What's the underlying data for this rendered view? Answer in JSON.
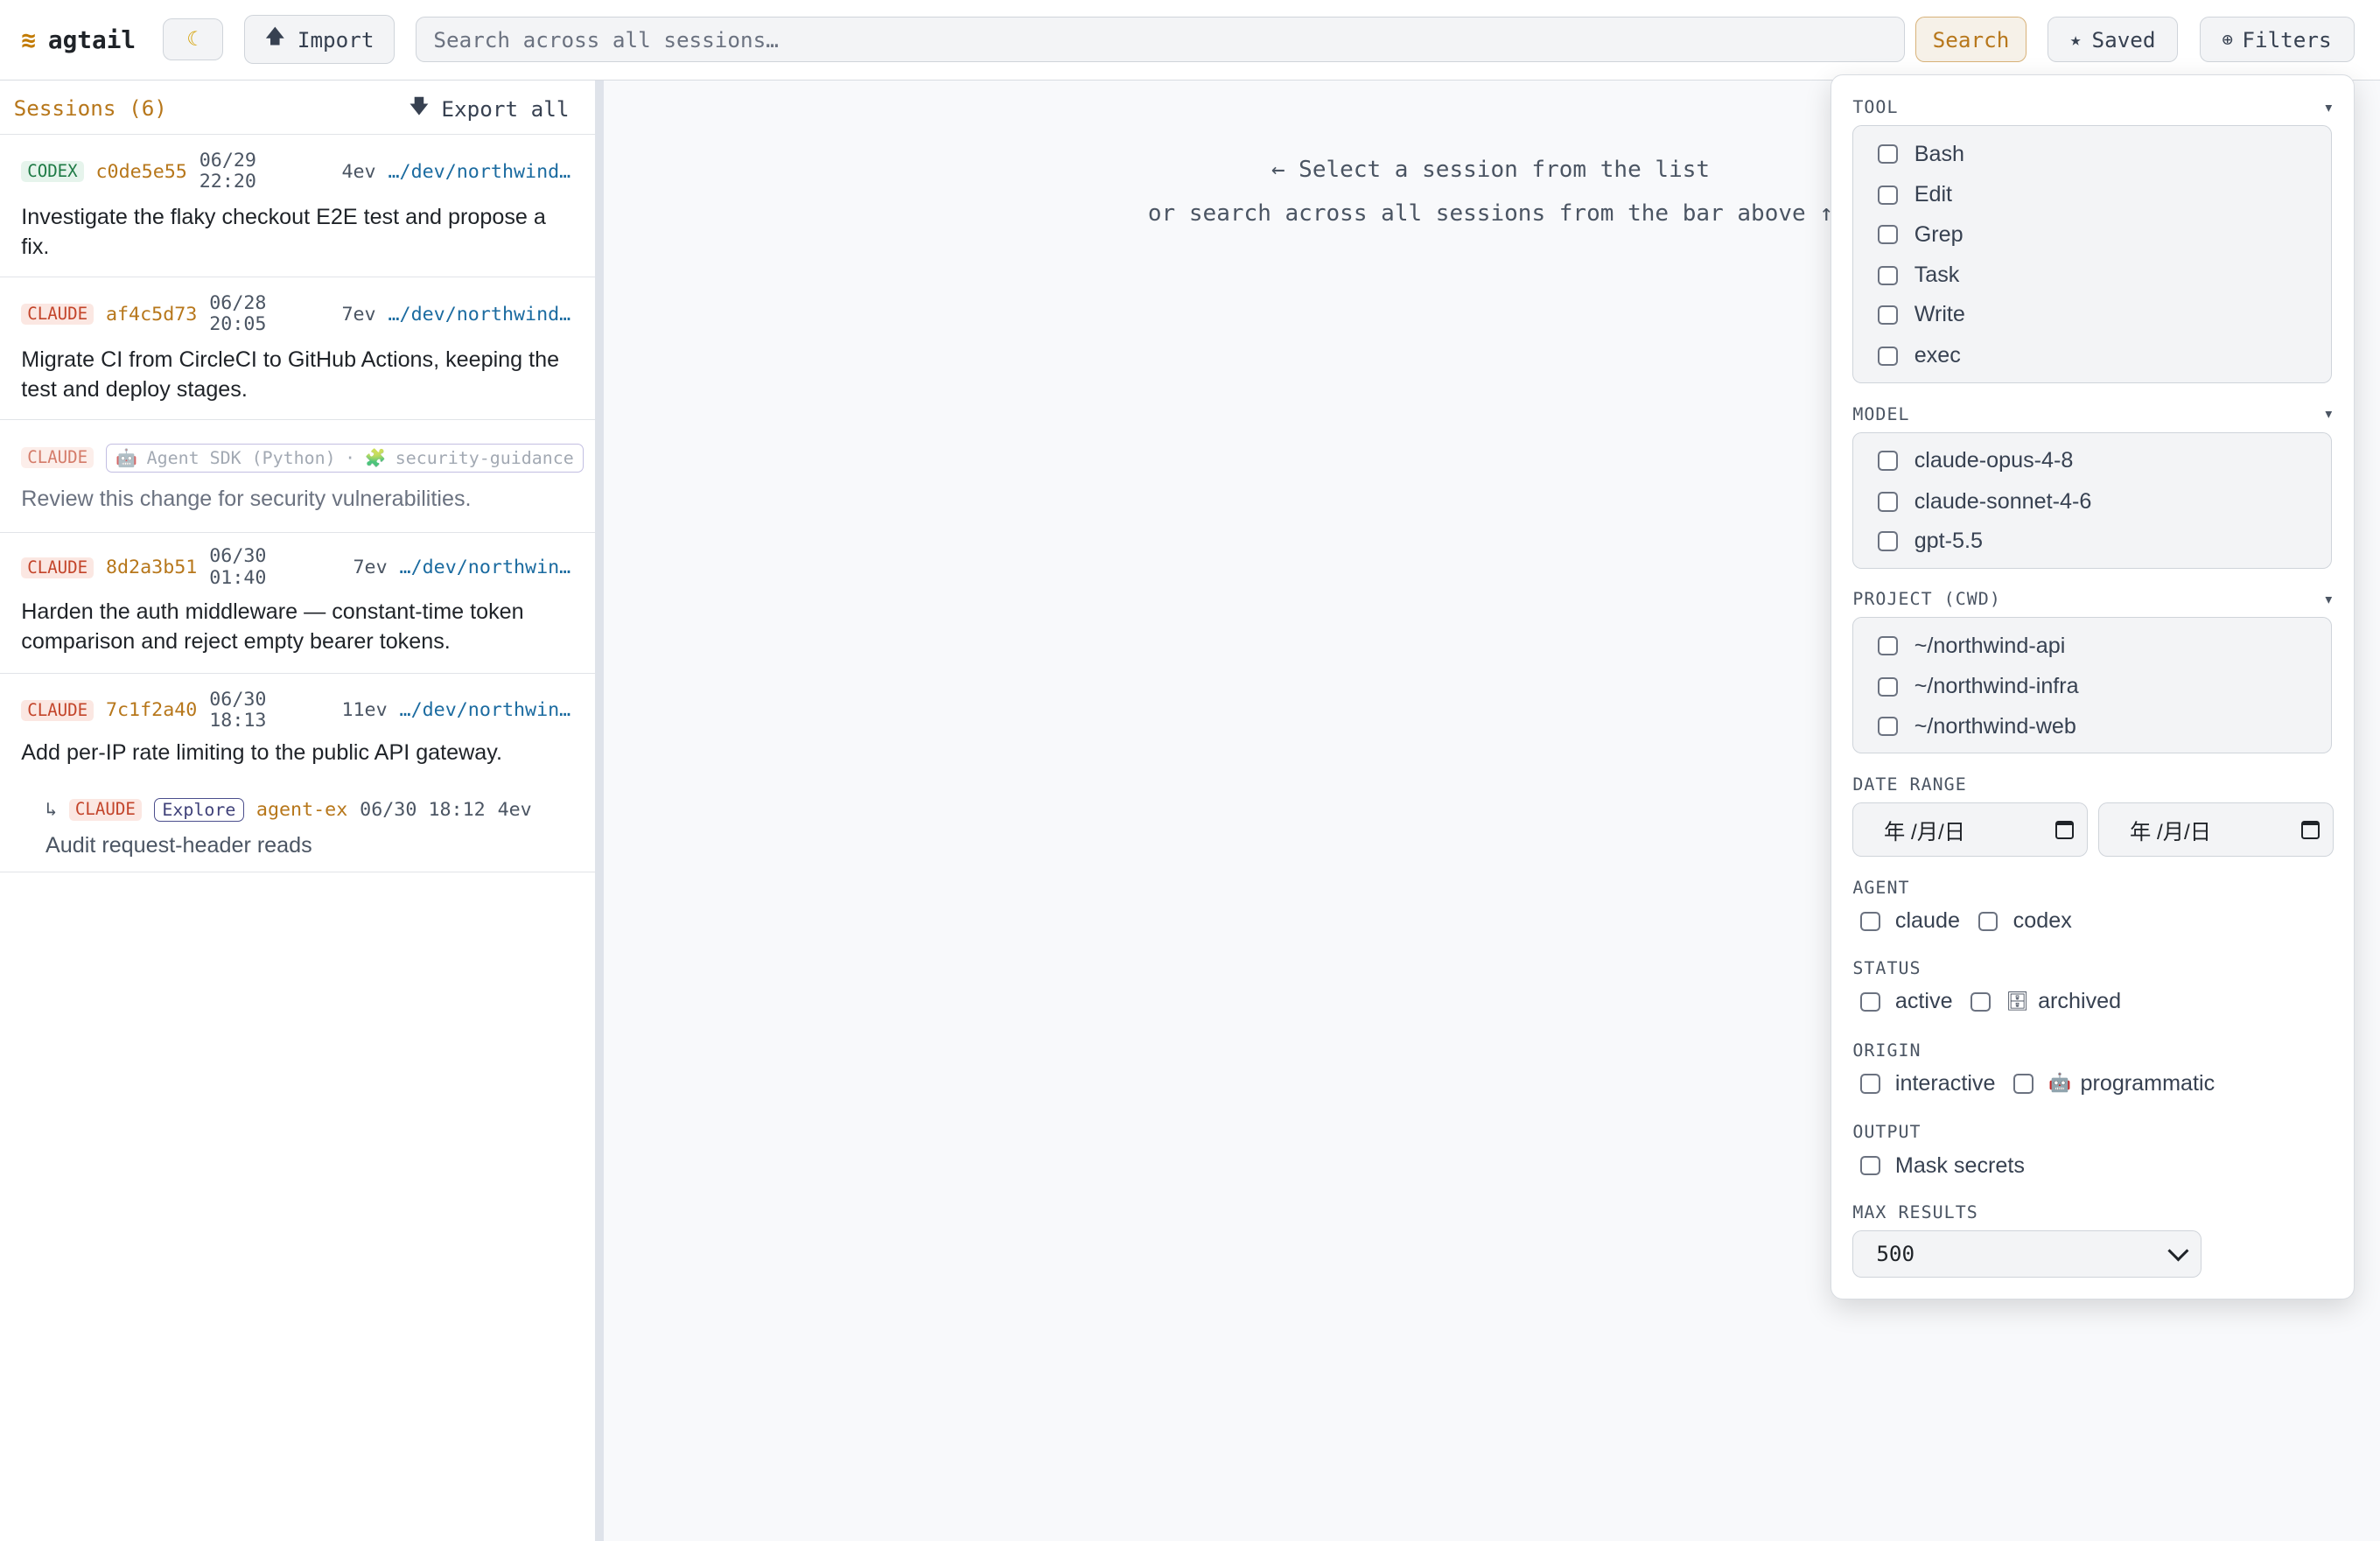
{
  "app": {
    "name": "agtail",
    "logo_glyph": "≋"
  },
  "toolbar": {
    "theme_icon": "☾",
    "import_label": "Import",
    "import_icon": "🡅",
    "search_placeholder": "Search across all sessions…",
    "search_label": "Search",
    "saved_label": "Saved",
    "saved_icon": "★",
    "filters_label": "Filters",
    "filters_icon": "⊕"
  },
  "sidebar": {
    "title": "Sessions (6)",
    "export_label": "Export all",
    "export_icon": "🡇",
    "sessions": [
      {
        "agent": "CODEX",
        "id": "c0de5e55",
        "date": "06/29",
        "time": "22:20",
        "events": "4ev",
        "path": "…/dev/northwind…",
        "title": "Investigate the flaky checkout E2E test and propose a fix."
      },
      {
        "agent": "CLAUDE",
        "id": "af4c5d73",
        "date": "06/28",
        "time": "20:05",
        "events": "7ev",
        "path": "…/dev/northwind…",
        "title": "Migrate CI from CircleCI to GitHub Actions, keeping the test and deploy stages."
      },
      {
        "agent": "CLAUDE",
        "origin": "Agent SDK (Python)",
        "separator": "·",
        "guidance": "security-guidance",
        "title": "Review this change for security vulnerabilities."
      },
      {
        "agent": "CLAUDE",
        "id": "8d2a3b51",
        "date": "06/30",
        "time": "01:40",
        "events": "7ev",
        "path": "…/dev/northwin…",
        "title": "Harden the auth middleware — constant-time token comparison and reject empty bearer tokens."
      },
      {
        "agent": "CLAUDE",
        "id": "7c1f2a40",
        "date": "06/30",
        "time": "18:13",
        "events": "11ev",
        "path": "…/dev/northwin…",
        "title": "Add per-IP rate limiting to the public API gateway."
      }
    ],
    "subagent": {
      "arrow": "↳",
      "agent": "CLAUDE",
      "type": "Explore",
      "name": "agent-ex",
      "datetime": "06/30 18:12",
      "events": "4ev",
      "title": "Audit request-header reads"
    }
  },
  "main": {
    "hint_line1": "← Select a session from the list",
    "hint_line2": "or search across all sessions from the bar above ↑"
  },
  "filters": {
    "tool": {
      "label": "TOOL",
      "options": [
        "Bash",
        "Edit",
        "Grep",
        "Task",
        "Write",
        "exec"
      ]
    },
    "model": {
      "label": "MODEL",
      "options": [
        "claude-opus-4-8",
        "claude-sonnet-4-6",
        "gpt-5.5"
      ]
    },
    "project": {
      "label": "PROJECT (CWD)",
      "options": [
        "~/northwind-api",
        "~/northwind-infra",
        "~/northwind-web"
      ]
    },
    "date_range": {
      "label": "DATE RANGE",
      "from_placeholder": "年 /月/日",
      "to_placeholder": "年 /月/日"
    },
    "agent": {
      "label": "AGENT",
      "options": [
        "claude",
        "codex"
      ]
    },
    "status": {
      "label": "STATUS",
      "options": [
        "active",
        "archived"
      ]
    },
    "origin": {
      "label": "ORIGIN",
      "options": [
        "interactive",
        "programmatic"
      ]
    },
    "output": {
      "label": "OUTPUT",
      "options": [
        "Mask secrets"
      ]
    },
    "max_results": {
      "label": "MAX RESULTS",
      "value": "500"
    },
    "caret": "▾"
  }
}
